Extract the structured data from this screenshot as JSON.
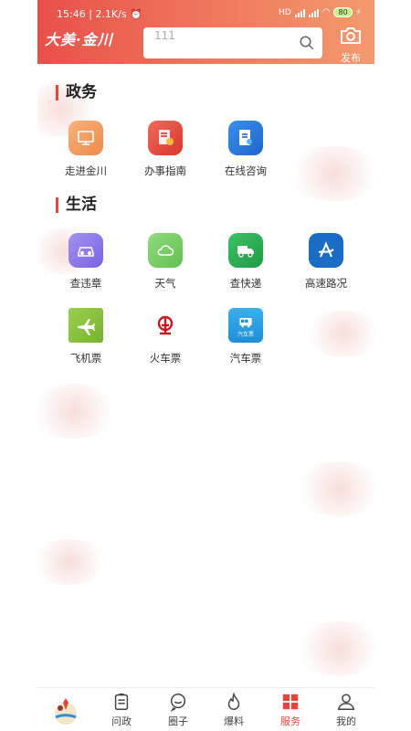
{
  "status_bar": {
    "time": "15:46",
    "speed": "2.1K/s",
    "battery": "80",
    "network": "HD"
  },
  "header": {
    "logo_text": "大美·金川",
    "search_value": "111",
    "publish_label": "发布"
  },
  "sections": [
    {
      "title": "政务",
      "items": [
        {
          "label": "走进金川",
          "icon": "monitor-icon",
          "color": "#f5a05c"
        },
        {
          "label": "办事指南",
          "icon": "guide-document-icon",
          "color": "#e5473f"
        },
        {
          "label": "在线咨询",
          "icon": "consult-document-icon",
          "color": "#2f7de1"
        }
      ]
    },
    {
      "title": "生活",
      "items": [
        {
          "label": "查违章",
          "icon": "car-icon",
          "color": "#8b77e8"
        },
        {
          "label": "天气",
          "icon": "cloud-icon",
          "color": "#7ccf6b"
        },
        {
          "label": "查快递",
          "icon": "truck-icon",
          "color": "#2fae55"
        },
        {
          "label": "高速路况",
          "icon": "highway-icon",
          "color": "#1b6cc4"
        },
        {
          "label": "飞机票",
          "icon": "plane-icon",
          "color": "#8cc63e"
        },
        {
          "label": "火车票",
          "icon": "railway-icon",
          "color": "#c9161d"
        },
        {
          "label": "汽车票",
          "icon": "bus-icon",
          "color": "#2aa0e0",
          "badge": "汽车票"
        }
      ]
    }
  ],
  "tabbar": {
    "tabs": [
      {
        "label": "问政",
        "icon": "clipboard-icon"
      },
      {
        "label": "圈子",
        "icon": "chat-bubble-icon"
      },
      {
        "label": "爆料",
        "icon": "flame-icon"
      },
      {
        "label": "服务",
        "icon": "grid-icon",
        "active": true
      },
      {
        "label": "我的",
        "icon": "user-icon"
      }
    ]
  }
}
